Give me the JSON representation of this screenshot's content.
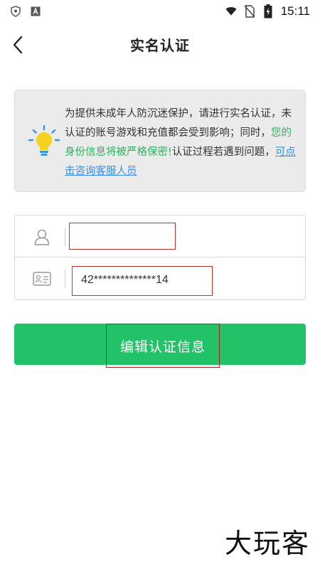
{
  "status_bar": {
    "time": "15:11",
    "left_icons": [
      "shield-icon",
      "a-letter-icon"
    ],
    "right_icons": [
      "wifi-icon",
      "no-sim-icon",
      "battery-icon"
    ]
  },
  "header": {
    "title": "实名认证"
  },
  "notice": {
    "text_part1": "为提供未成年人防沉迷保护，请进行实名认证，未认证的账号游戏和充值都会受到影响；同时，",
    "highlight": "您的身份信息将被严格保密!",
    "text_part2": "认证过程若遇到问题，",
    "link": "可点击咨询客服人员"
  },
  "form": {
    "name_value": "",
    "id_value": "42**************14"
  },
  "button": {
    "label": "编辑认证信息"
  },
  "watermark": "大玩客",
  "colors": {
    "accent_green": "#21c268",
    "highlight_green": "#2bb45e",
    "link_blue": "#3a8ee6",
    "annotation_red": "#c9302c"
  }
}
